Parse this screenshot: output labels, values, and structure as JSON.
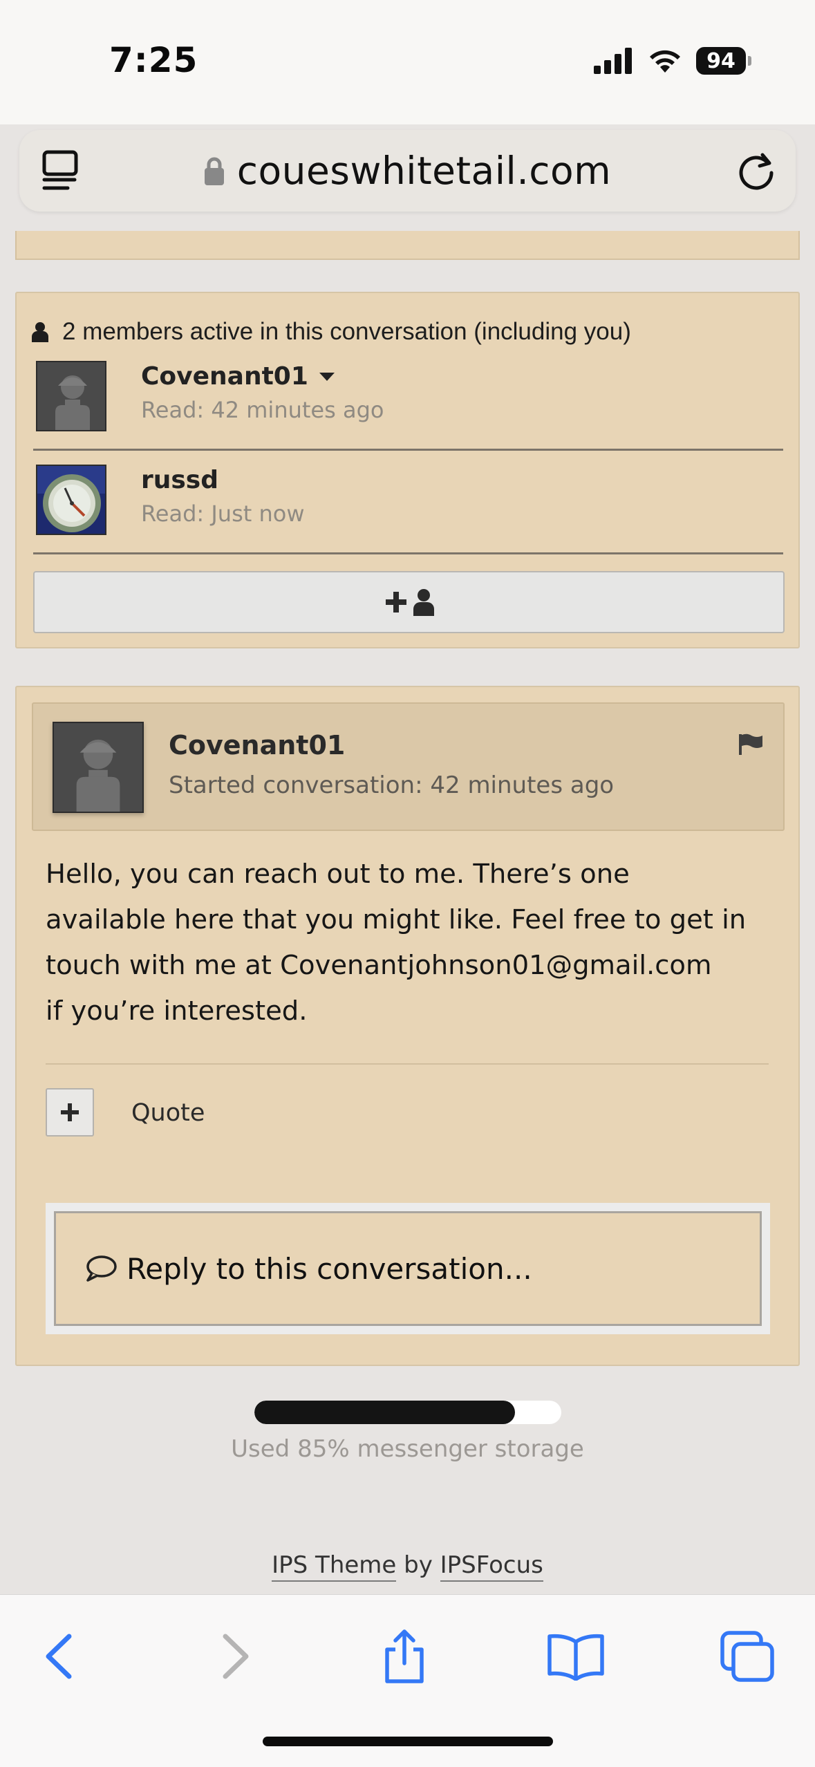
{
  "status_bar": {
    "time": "7:25",
    "battery": "94"
  },
  "browser": {
    "url": "coueswhitetail.com"
  },
  "members": {
    "header": "2 members active in this conversation (including you)",
    "items": [
      {
        "name": "Covenant01",
        "read": "Read: 42 minutes ago",
        "has_menu": true
      },
      {
        "name": "russd",
        "read": "Read: Just now",
        "has_menu": false
      }
    ]
  },
  "message": {
    "author": "Covenant01",
    "started": "Started conversation: 42 minutes ago",
    "body_lines": [
      "Hello, you can reach out to me. There’s one",
      "available here that you might like. Feel free to get in",
      "touch with me at Covenantjohnson01@gmail.com",
      "if you’re interested."
    ],
    "quote_label": "Quote",
    "add_button": "+"
  },
  "reply": {
    "placeholder": "Reply to this conversation..."
  },
  "storage": {
    "used_fraction": 0.85,
    "text": "Used 85% messenger storage"
  },
  "footer": {
    "theme_link": "IPS Theme",
    "by": "by",
    "focus_link": "IPSFocus"
  },
  "colors": {
    "panel_bg": "#e8d5b6",
    "page_bg": "#e7e4e2",
    "safari_blue": "#3478f6"
  }
}
